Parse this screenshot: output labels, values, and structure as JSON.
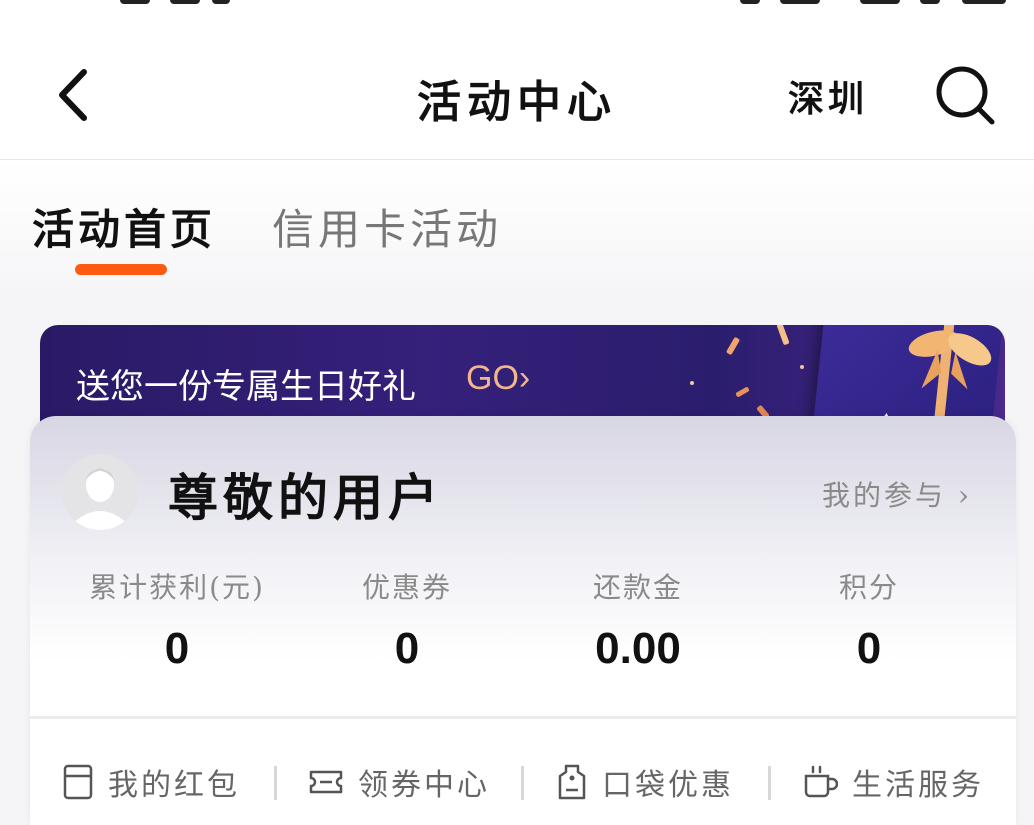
{
  "header": {
    "title": "活动中心",
    "city": "深圳",
    "back_icon": "chevron-left-icon",
    "search_icon": "search-icon"
  },
  "tabs": [
    {
      "label": "活动首页",
      "active": true
    },
    {
      "label": "信用卡活动",
      "active": false
    }
  ],
  "accent_color": "#ff5a12",
  "banner": {
    "text": "送您一份专属生日好礼",
    "cta": "GO›"
  },
  "user": {
    "name": "尊敬的用户",
    "participation_link": "我的参与 ›"
  },
  "stats": [
    {
      "label": "累计获利(元)",
      "value": "0"
    },
    {
      "label": "优惠券",
      "value": "0"
    },
    {
      "label": "还款金",
      "value": "0.00"
    },
    {
      "label": "积分",
      "value": "0"
    }
  ],
  "services": [
    {
      "label": "我的红包",
      "icon": "red-packet-icon"
    },
    {
      "label": "领券中心",
      "icon": "coupon-icon"
    },
    {
      "label": "口袋优惠",
      "icon": "tag-icon"
    },
    {
      "label": "生活服务",
      "icon": "coffee-cup-icon"
    }
  ]
}
